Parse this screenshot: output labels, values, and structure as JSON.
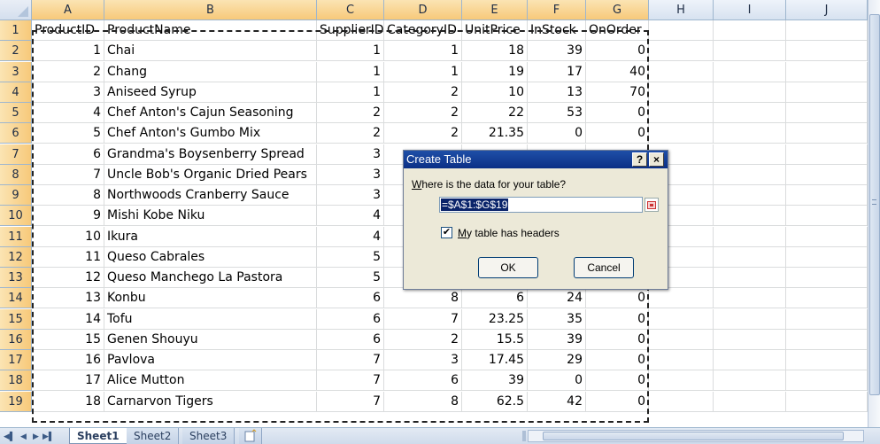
{
  "columns": [
    "A",
    "B",
    "C",
    "D",
    "E",
    "F",
    "G",
    "H",
    "I",
    "J"
  ],
  "selected_columns": [
    "A",
    "B",
    "C",
    "D",
    "E",
    "F",
    "G"
  ],
  "header_row": [
    "ProductID",
    "ProductName",
    "SupplierID",
    "CategoryID",
    "UnitPrice",
    "InStock",
    "OnOrder"
  ],
  "rows": [
    [
      "1",
      "Chai",
      "1",
      "1",
      "18",
      "39",
      "0"
    ],
    [
      "2",
      "Chang",
      "1",
      "1",
      "19",
      "17",
      "40"
    ],
    [
      "3",
      "Aniseed Syrup",
      "1",
      "2",
      "10",
      "13",
      "70"
    ],
    [
      "4",
      "Chef Anton's Cajun Seasoning",
      "2",
      "2",
      "22",
      "53",
      "0"
    ],
    [
      "5",
      "Chef Anton's Gumbo Mix",
      "2",
      "2",
      "21.35",
      "0",
      "0"
    ],
    [
      "6",
      "Grandma's Boysenberry Spread",
      "3",
      "",
      "",
      "",
      ""
    ],
    [
      "7",
      "Uncle Bob's Organic Dried Pears",
      "3",
      "",
      "",
      "",
      ""
    ],
    [
      "8",
      "Northwoods Cranberry Sauce",
      "3",
      "",
      "",
      "",
      ""
    ],
    [
      "9",
      "Mishi Kobe Niku",
      "4",
      "",
      "",
      "",
      ""
    ],
    [
      "10",
      "Ikura",
      "4",
      "",
      "",
      "",
      ""
    ],
    [
      "11",
      "Queso Cabrales",
      "5",
      "",
      "",
      "",
      ""
    ],
    [
      "12",
      "Queso Manchego La Pastora",
      "5",
      "",
      "",
      "",
      ""
    ],
    [
      "13",
      "Konbu",
      "6",
      "8",
      "6",
      "24",
      "0"
    ],
    [
      "14",
      "Tofu",
      "6",
      "7",
      "23.25",
      "35",
      "0"
    ],
    [
      "15",
      "Genen Shouyu",
      "6",
      "2",
      "15.5",
      "39",
      "0"
    ],
    [
      "16",
      "Pavlova",
      "7",
      "3",
      "17.45",
      "29",
      "0"
    ],
    [
      "17",
      "Alice Mutton",
      "7",
      "6",
      "39",
      "0",
      "0"
    ],
    [
      "18",
      "Carnarvon Tigers",
      "7",
      "8",
      "62.5",
      "42",
      "0"
    ]
  ],
  "row_numbers": [
    "1",
    "2",
    "3",
    "4",
    "5",
    "6",
    "7",
    "8",
    "9",
    "10",
    "11",
    "12",
    "13",
    "14",
    "15",
    "16",
    "17",
    "18",
    "19"
  ],
  "sheets": [
    {
      "label": "Sheet1",
      "active": true
    },
    {
      "label": "Sheet2",
      "active": false
    },
    {
      "label": "Sheet3",
      "active": false
    }
  ],
  "dialog": {
    "title": "Create Table",
    "help_glyph": "?",
    "close_glyph": "×",
    "prompt_accel": "W",
    "prompt_rest": "here is the data for your table?",
    "range_value": "=$A$1:$G$19",
    "checkbox_checked": true,
    "checkbox_mark": "✔",
    "checkbox_accel": "M",
    "checkbox_rest": "y table has headers",
    "ok_label": "OK",
    "cancel_label": "Cancel"
  },
  "icons": {
    "nav_first": "first-sheet-icon",
    "nav_prev": "prev-sheet-icon",
    "nav_next": "next-sheet-icon",
    "nav_last": "last-sheet-icon",
    "insert_sheet": "insert-sheet-icon",
    "collapse_dialog": "collapse-dialog-icon"
  },
  "colors": {
    "title_bar": "#0a2f86",
    "selected_header": "#f7c97a",
    "range_highlight": "#0a246a"
  }
}
